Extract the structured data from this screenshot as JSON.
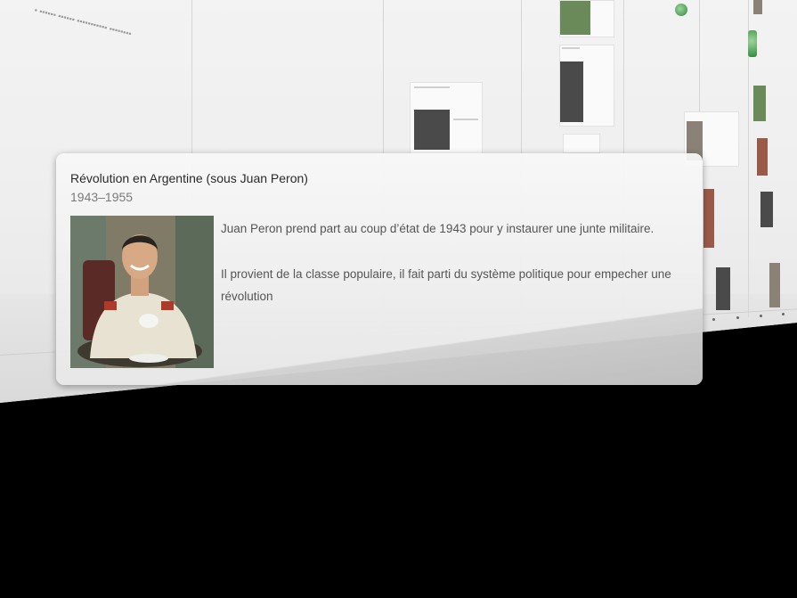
{
  "event": {
    "title": "Révolution en Argentine (sous Juan Peron)",
    "dates": "1943–1955",
    "description": [
      "Juan Peron prend part au coup d’état de 1943 pour y instaurer une junte militaire.",
      "Il provient de la classe populaire, il fait parti du système politique pour empecher une révolution"
    ],
    "photo_icon": "portrait-photo"
  },
  "background": {
    "colors": {
      "timeline": "#eeeeee",
      "void": "#000000",
      "card": "#f0f0f0"
    }
  }
}
